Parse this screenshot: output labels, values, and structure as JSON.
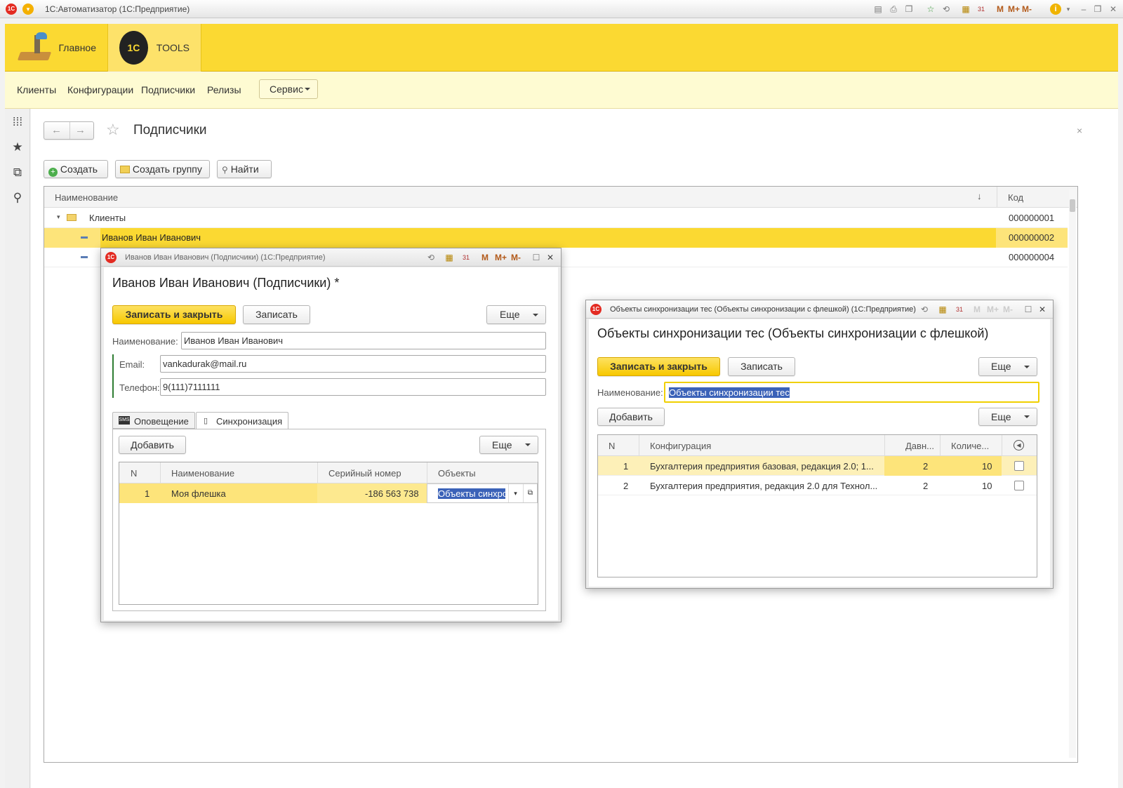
{
  "app": {
    "title": "1С:Автоматизатор  (1С:Предприятие)",
    "logo": "1С"
  },
  "titlebar_icons": [
    "save-icon",
    "print-icon",
    "copy-icon",
    "favorites-icon",
    "history-icon",
    "calculator-icon",
    "calendar-icon",
    "memory-icon",
    "info-icon",
    "minimize-icon",
    "restore-icon",
    "close-icon"
  ],
  "memory": {
    "m": "M",
    "mplus": "M+",
    "mminus": "M-"
  },
  "sections": [
    {
      "label": "Главное",
      "icon": "desk-lamp-icon"
    },
    {
      "label": "TOOLS",
      "icon": "1c-gear-icon"
    }
  ],
  "nav": {
    "items": [
      "Клиенты",
      "Конфигурации",
      "Подписчики",
      "Релизы"
    ],
    "service": "Сервис"
  },
  "page": {
    "title": "Подписчики"
  },
  "toolbar": {
    "create": "Создать",
    "create_group": "Создать группу",
    "find": "Найти"
  },
  "list": {
    "columns": [
      "Наименование",
      "Код"
    ],
    "rows": [
      {
        "name": "Клиенты",
        "code": "000000001",
        "type": "folder"
      },
      {
        "name": "Иванов Иван Иванович",
        "code": "000000002",
        "type": "item",
        "selected": true
      },
      {
        "name": "",
        "code": "000000004",
        "type": "item"
      }
    ]
  },
  "form1": {
    "window_title": "Иванов Иван Иванович (Подписчики)  (1С:Предприятие)",
    "title": "Иванов Иван Иванович (Подписчики) *",
    "save_close": "Записать и закрыть",
    "save": "Записать",
    "more": "Еще",
    "name_label": "Наименование:",
    "name_value": "Иванов Иван Иванович",
    "email_label": "Email:",
    "email_value": "vankadurak@mail.ru",
    "phone_label": "Телефон:",
    "phone_value": "9(111)7111111",
    "tabs": [
      "Оповещение",
      "Синхронизация"
    ],
    "add": "Добавить",
    "more2": "Еще",
    "table": {
      "columns": [
        "N",
        "Наименование",
        "Серийный номер",
        "Объекты"
      ],
      "rows": [
        {
          "n": "1",
          "name": "Моя флешка",
          "serial": "-186 563 738",
          "objects": "Объекты синхро"
        }
      ]
    }
  },
  "form2": {
    "window_title": "Объекты синхронизации тес (Объекты синхронизации с флешкой)  (1С:Предприятие)",
    "title": "Объекты синхронизации тес (Объекты синхронизации с флешкой)",
    "save_close": "Записать и закрыть",
    "save": "Записать",
    "more": "Еще",
    "name_label": "Наименование:",
    "name_value": "Объекты синхронизации тес",
    "add": "Добавить",
    "more2": "Еще",
    "table": {
      "columns": [
        "N",
        "Конфигурация",
        "Давн...",
        "Количе..."
      ],
      "rows": [
        {
          "n": "1",
          "config": "Бухгалтерия предприятия базовая, редакция 2.0; 1...",
          "davn": "2",
          "qty": "10"
        },
        {
          "n": "2",
          "config": "Бухгалтерия предприятия, редакция 2.0 для Технол...",
          "davn": "2",
          "qty": "10"
        }
      ]
    }
  },
  "colors": {
    "accent_yellow": "#fbd932",
    "nav_bg": "#fefbd2",
    "selection_row": "#fde47a",
    "text_selection": "#3b62b8"
  }
}
